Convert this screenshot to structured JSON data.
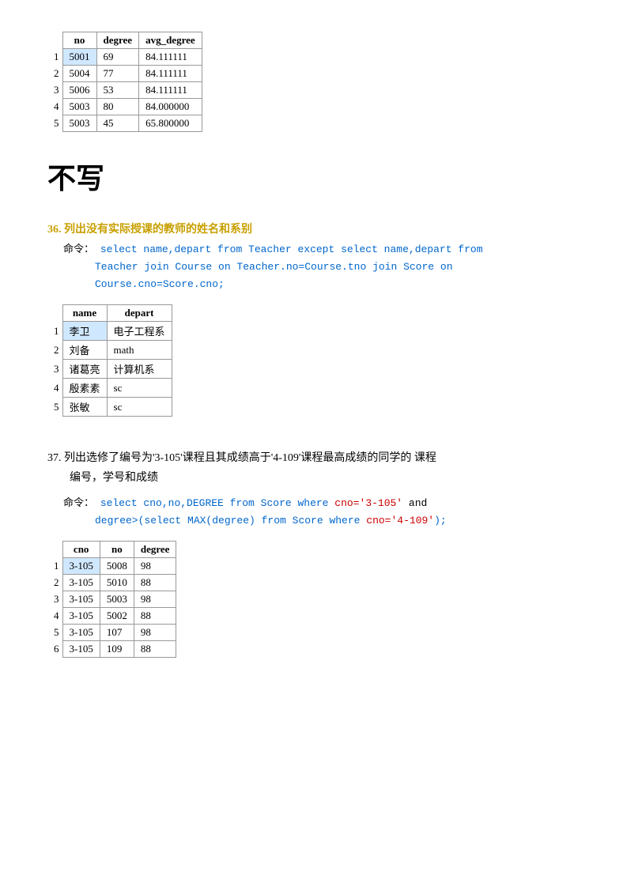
{
  "table1": {
    "headers": [
      "no",
      "degree",
      "avg_degree"
    ],
    "rows": [
      {
        "num": "1",
        "no": "5001",
        "degree": "69",
        "avg_degree": "84.111111",
        "highlight": true
      },
      {
        "num": "2",
        "no": "5004",
        "degree": "77",
        "avg_degree": "84.111111",
        "highlight": false
      },
      {
        "num": "3",
        "no": "5006",
        "degree": "53",
        "avg_degree": "84.111111",
        "highlight": false
      },
      {
        "num": "4",
        "no": "5003",
        "degree": "80",
        "avg_degree": "84.000000",
        "highlight": false
      },
      {
        "num": "5",
        "no": "5003",
        "degree": "45",
        "avg_degree": "65.800000",
        "highlight": false
      }
    ]
  },
  "bu_xie": "不写",
  "q36": {
    "num": "36.",
    "title": "列出没有实际授课的教师的姓名和系别",
    "cmd_label": "命令：",
    "cmd_parts": [
      {
        "text": "select name,depart from Teacher except select name,depart from",
        "type": "keyword"
      },
      {
        "text": "Teacher join Course on Teacher.no=Course.tno",
        "type": "keyword"
      },
      {
        "text": "join Score on",
        "type": "keyword"
      },
      {
        "text": "Course.cno=Score.cno;",
        "type": "keyword"
      }
    ],
    "table": {
      "headers": [
        "name",
        "depart"
      ],
      "rows": [
        {
          "num": "1",
          "name": "李卫",
          "depart": "电子工程系",
          "highlight": true
        },
        {
          "num": "2",
          "name": "刘备",
          "depart": "math",
          "highlight": false
        },
        {
          "num": "3",
          "name": "诸葛亮",
          "depart": "计算机系",
          "highlight": false
        },
        {
          "num": "4",
          "name": "殷素素",
          "depart": "sc",
          "highlight": false
        },
        {
          "num": "5",
          "name": "张敏",
          "depart": "sc",
          "highlight": false
        }
      ]
    }
  },
  "q37": {
    "num": "37.",
    "title_line1": "列出选修了编号为'3-105'课程且其成绩高于'4-109'课程最高成绩的同学的 课程",
    "title_line2": "编号，学号和成绩",
    "cmd_label": "命令：",
    "cmd_text1": "select cno,no,DEGREE from Score where",
    "cmd_string1": "cno='3-105'",
    "cmd_text2": "and",
    "cmd_text3": "degree>(select MAX(degree) from Score where",
    "cmd_string2": "cno='4-109'",
    "cmd_text4": ");",
    "table": {
      "headers": [
        "cno",
        "no",
        "degree"
      ],
      "rows": [
        {
          "num": "1",
          "cno": "3-105",
          "no": "5008",
          "degree": "98",
          "highlight": true
        },
        {
          "num": "2",
          "cno": "3-105",
          "no": "5010",
          "degree": "88",
          "highlight": false
        },
        {
          "num": "3",
          "cno": "3-105",
          "no": "5003",
          "degree": "98",
          "highlight": false
        },
        {
          "num": "4",
          "cno": "3-105",
          "no": "5002",
          "degree": "88",
          "highlight": false
        },
        {
          "num": "5",
          "cno": "3-105",
          "no": "107",
          "degree": "98",
          "highlight": false
        },
        {
          "num": "6",
          "cno": "3-105",
          "no": "109",
          "degree": "88",
          "highlight": false
        }
      ]
    }
  }
}
